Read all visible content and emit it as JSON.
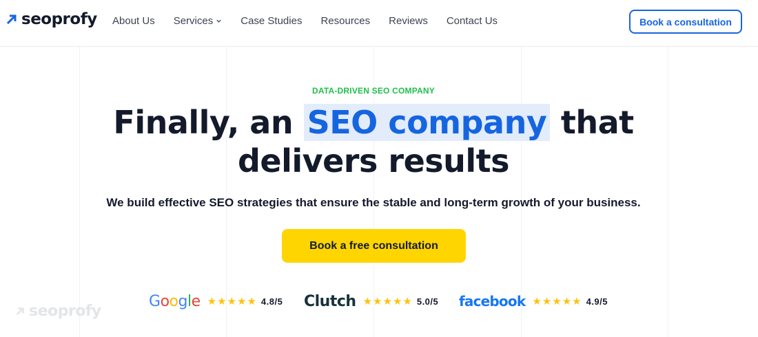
{
  "header": {
    "logo_text": "seoprofy",
    "nav": [
      {
        "label": "About Us"
      },
      {
        "label": "Services"
      },
      {
        "label": "Case Studies"
      },
      {
        "label": "Resources"
      },
      {
        "label": "Reviews"
      },
      {
        "label": "Contact Us"
      }
    ],
    "cta_label": "Book a consultation"
  },
  "hero": {
    "eyebrow": "DATA-DRIVEN SEO COMPANY",
    "headline_part1": "Finally, an",
    "headline_highlight": "SEO company",
    "headline_part2": "that",
    "headline_line2": "delivers results",
    "subtitle": "We build effective SEO strategies that ensure the stable and long-term growth of your business.",
    "cta_label": "Book a free consultation"
  },
  "ratings": [
    {
      "brand": "Google",
      "score": "4.8/5",
      "stars": 5
    },
    {
      "brand": "Clutch",
      "score": "5.0/5",
      "stars": 5
    },
    {
      "brand": "facebook",
      "score": "4.9/5",
      "stars": 5
    }
  ],
  "watermark": {
    "text": "seoprofy"
  },
  "colors": {
    "brand_blue": "#1665e0",
    "accent_yellow": "#ffd500",
    "eyebrow_green": "#1fbf4a",
    "star_gold": "#ffc20e",
    "text_dark": "#131a2b"
  }
}
